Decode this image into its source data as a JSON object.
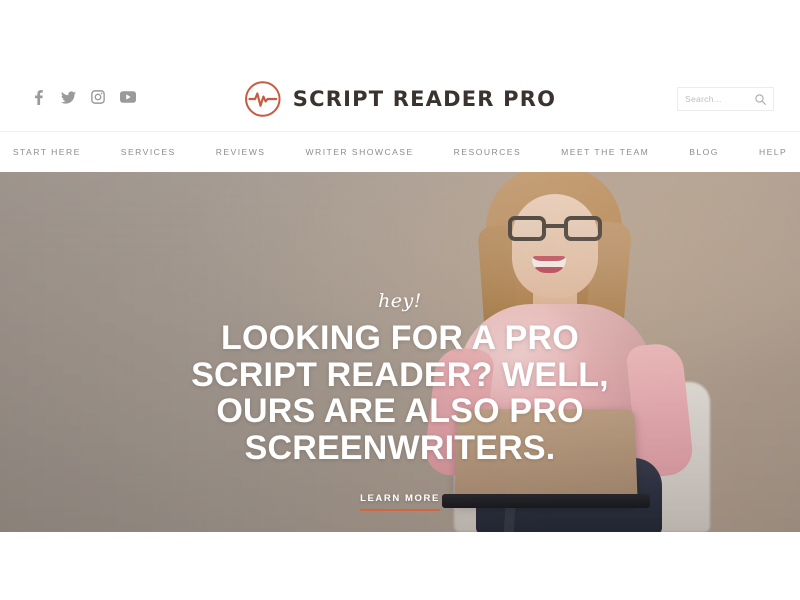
{
  "brand": {
    "name": "SCRIPT READER PRO",
    "logo_icon": "pulse-circle-icon",
    "accent_color": "#c75b3f",
    "text_color": "#3a3330"
  },
  "social": {
    "items": [
      {
        "name": "facebook",
        "icon": "facebook-icon",
        "label": "Facebook"
      },
      {
        "name": "twitter",
        "icon": "twitter-icon",
        "label": "Twitter"
      },
      {
        "name": "instagram",
        "icon": "instagram-icon",
        "label": "Instagram"
      },
      {
        "name": "youtube",
        "icon": "youtube-icon",
        "label": "YouTube"
      }
    ]
  },
  "search": {
    "placeholder": "Search...",
    "value": "",
    "icon": "search-icon"
  },
  "nav": {
    "items": [
      {
        "label": "START HERE"
      },
      {
        "label": "SERVICES"
      },
      {
        "label": "REVIEWS"
      },
      {
        "label": "WRITER SHOWCASE"
      },
      {
        "label": "RESOURCES"
      },
      {
        "label": "MEET THE TEAM"
      },
      {
        "label": "BLOG"
      },
      {
        "label": "HELP"
      }
    ]
  },
  "hero": {
    "eyebrow": "hey!",
    "title": "LOOKING FOR A PRO SCRIPT READER? WELL, OURS ARE ALSO PRO SCREENWRITERS.",
    "cta_label": "LEARN MORE",
    "cta_underline_color": "#d4663f",
    "background_left_color": "#a49a92",
    "background_right_color": "#ab9a8c",
    "image_description": "Smiling woman with glasses in a pink sweater working on a laptop against a tan wall"
  }
}
